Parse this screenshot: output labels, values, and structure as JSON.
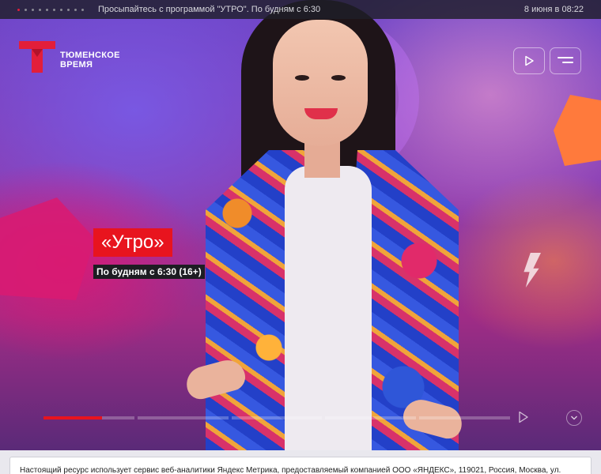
{
  "topbar": {
    "slide_count": 10,
    "active_slide": 1,
    "ticker": "Просыпайтесь с программой \"УТРО\". По будням с 6:30",
    "datetime": "8 июня в 08:22"
  },
  "logo": {
    "line1": "ТЮМЕНСКОЕ",
    "line2": "ВРЕМЯ",
    "brand_color": "#e31e3a"
  },
  "header": {
    "play_icon": "play-icon",
    "menu_icon": "menu-icon"
  },
  "hero": {
    "title": "«Утро»",
    "subtitle": "По будням с 6:30 (16+)",
    "accent": "#e8141e"
  },
  "slider": {
    "segments": 5,
    "progress_fraction": 0.125,
    "next_icon": "chevron-right-icon",
    "down_icon": "chevron-down-icon"
  },
  "notice": {
    "text": "Настоящий ресурс использует сервис веб-аналитики Яндекс Метрика, предоставляемый компанией ООО «ЯНДЕКС», 119021, Россия, Москва, ул."
  }
}
